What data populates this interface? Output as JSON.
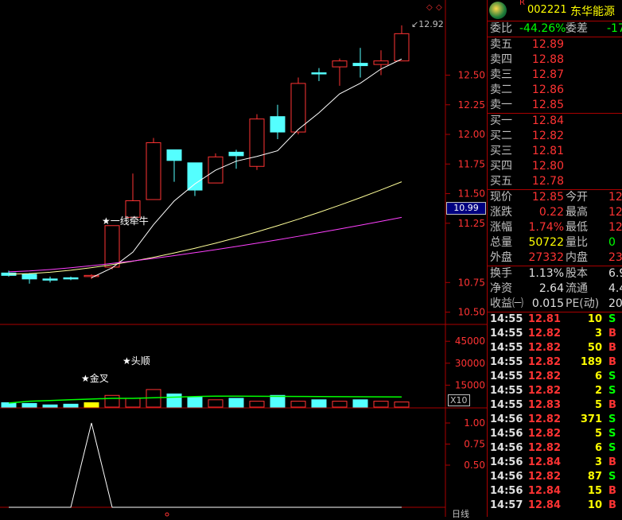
{
  "header": {
    "badge": "R",
    "code": "002221",
    "name": "东华能源"
  },
  "summary": {
    "weibi_label": "委比",
    "weibi_value": "-44.26%",
    "weicha_label": "委差",
    "weicha_value": "-17"
  },
  "asks": [
    {
      "label": "卖五",
      "price": "12.89"
    },
    {
      "label": "卖四",
      "price": "12.88"
    },
    {
      "label": "卖三",
      "price": "12.87"
    },
    {
      "label": "卖二",
      "price": "12.86"
    },
    {
      "label": "卖一",
      "price": "12.85"
    }
  ],
  "bids": [
    {
      "label": "买一",
      "price": "12.84"
    },
    {
      "label": "买二",
      "price": "12.82"
    },
    {
      "label": "买三",
      "price": "12.81"
    },
    {
      "label": "买四",
      "price": "12.80"
    },
    {
      "label": "买五",
      "price": "12.78"
    }
  ],
  "quote": [
    {
      "l1": "现价",
      "v1": "12.85",
      "l2": "今开",
      "v2": "12"
    },
    {
      "l1": "涨跌",
      "v1": "0.22",
      "l2": "最高",
      "v2": "12"
    },
    {
      "l1": "涨幅",
      "v1": "1.74%",
      "l2": "最低",
      "v2": "12"
    },
    {
      "l1": "总量",
      "v1": "50722",
      "l2": "量比",
      "v2": "0"
    },
    {
      "l1": "外盘",
      "v1": "27332",
      "l2": "内盘",
      "v2": "233"
    }
  ],
  "finance": [
    {
      "l1": "换手",
      "v1": "1.13%",
      "l2": "股本",
      "v2": "6.9"
    },
    {
      "l1": "净资",
      "v1": "2.64",
      "l2": "流通",
      "v2": "4.4"
    },
    {
      "l1": "收益㈠",
      "v1": "0.015",
      "l2": "PE(动)",
      "v2": "20"
    }
  ],
  "ticks": [
    {
      "time": "14:55",
      "price": "12.81",
      "vol": "10",
      "side": "S"
    },
    {
      "time": "14:55",
      "price": "12.82",
      "vol": "3",
      "side": "B"
    },
    {
      "time": "14:55",
      "price": "12.82",
      "vol": "50",
      "side": "B"
    },
    {
      "time": "14:55",
      "price": "12.82",
      "vol": "189",
      "side": "B"
    },
    {
      "time": "14:55",
      "price": "12.82",
      "vol": "6",
      "side": "S"
    },
    {
      "time": "14:55",
      "price": "12.82",
      "vol": "2",
      "side": "S"
    },
    {
      "time": "14:55",
      "price": "12.83",
      "vol": "5",
      "side": "B"
    },
    {
      "time": "14:56",
      "price": "12.82",
      "vol": "371",
      "side": "S"
    },
    {
      "time": "14:56",
      "price": "12.82",
      "vol": "5",
      "side": "S"
    },
    {
      "time": "14:56",
      "price": "12.82",
      "vol": "6",
      "side": "S"
    },
    {
      "time": "14:56",
      "price": "12.84",
      "vol": "3",
      "side": "B"
    },
    {
      "time": "14:56",
      "price": "12.82",
      "vol": "87",
      "side": "S"
    },
    {
      "time": "14:56",
      "price": "12.84",
      "vol": "15",
      "side": "B"
    },
    {
      "time": "14:57",
      "price": "12.84",
      "vol": "10",
      "side": "B"
    }
  ],
  "chart": {
    "price_axis": [
      "12.50",
      "12.25",
      "12.00",
      "11.75",
      "11.50",
      "11.25",
      "10.75",
      "10.50"
    ],
    "volume_axis": [
      "45000",
      "30000",
      "15000"
    ],
    "indicator_axis": [
      "1.00",
      "0.75",
      "0.50"
    ],
    "current_price_tag": "10.99",
    "high_label": "12.92",
    "annotation_yixian": "★一线牵牛",
    "annotation_jincha": "★金叉",
    "annotation_toushun": "★头顺",
    "volume_multiplier": "X10",
    "period_label": "日线",
    "colors": {
      "up": "#ff3333",
      "down": "#54ffff",
      "ma5": "#ffffff",
      "ma10": "#ffff99",
      "ma20": "#ff40ff"
    }
  },
  "chart_data": {
    "type": "candlestick",
    "candles": [
      {
        "o": 10.83,
        "h": 10.85,
        "l": 10.8,
        "c": 10.81
      },
      {
        "o": 10.82,
        "h": 10.83,
        "l": 10.74,
        "c": 10.78
      },
      {
        "o": 10.78,
        "h": 10.8,
        "l": 10.75,
        "c": 10.77
      },
      {
        "o": 10.79,
        "h": 10.8,
        "l": 10.77,
        "c": 10.78
      },
      {
        "o": 10.8,
        "h": 10.82,
        "l": 10.78,
        "c": 10.81
      },
      {
        "o": 10.88,
        "h": 11.23,
        "l": 10.86,
        "c": 11.23
      },
      {
        "o": 11.3,
        "h": 11.67,
        "l": 11.3,
        "c": 11.44
      },
      {
        "o": 11.45,
        "h": 11.97,
        "l": 11.45,
        "c": 11.93
      },
      {
        "o": 11.87,
        "h": 11.87,
        "l": 11.6,
        "c": 11.78
      },
      {
        "o": 11.76,
        "h": 11.76,
        "l": 11.48,
        "c": 11.53
      },
      {
        "o": 11.59,
        "h": 11.84,
        "l": 11.59,
        "c": 11.81
      },
      {
        "o": 11.85,
        "h": 11.87,
        "l": 11.71,
        "c": 11.82
      },
      {
        "o": 11.73,
        "h": 12.17,
        "l": 11.7,
        "c": 12.13
      },
      {
        "o": 12.15,
        "h": 12.25,
        "l": 11.96,
        "c": 12.02
      },
      {
        "o": 12.02,
        "h": 12.48,
        "l": 12.0,
        "c": 12.43
      },
      {
        "o": 12.52,
        "h": 12.56,
        "l": 12.45,
        "c": 12.51
      },
      {
        "o": 12.57,
        "h": 12.64,
        "l": 12.41,
        "c": 12.62
      },
      {
        "o": 12.6,
        "h": 12.73,
        "l": 12.48,
        "c": 12.58
      },
      {
        "o": 12.59,
        "h": 12.71,
        "l": 12.5,
        "c": 12.62
      },
      {
        "o": 12.62,
        "h": 12.92,
        "l": 12.62,
        "c": 12.85
      }
    ],
    "volumes": [
      3000,
      2500,
      1500,
      2000,
      3000,
      8000,
      6000,
      12000,
      9000,
      7000,
      5000,
      6000,
      4000,
      8000,
      4000,
      5000,
      4000,
      5000,
      4000,
      3500
    ],
    "indicator": [
      0,
      0,
      0,
      0,
      1,
      0,
      0,
      0,
      0,
      0,
      0,
      0,
      0,
      0,
      0,
      0,
      0,
      0,
      0,
      0
    ],
    "ylim_price": [
      10.5,
      12.95
    ]
  }
}
